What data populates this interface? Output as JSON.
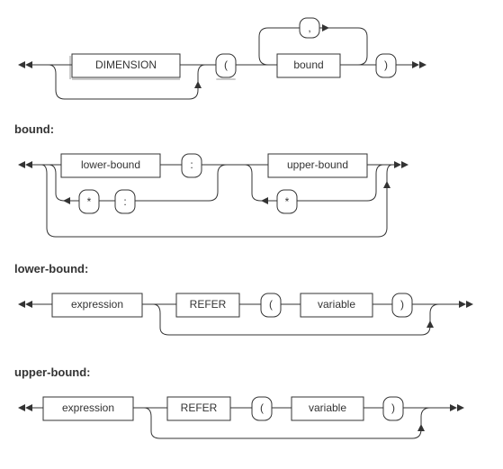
{
  "diagram1": {
    "dimension": "DIMENSION",
    "open_paren": "(",
    "bound": "bound",
    "comma": ",",
    "close_paren": ")"
  },
  "labels": {
    "bound": "bound:",
    "lower": "lower-bound:",
    "upper": "upper-bound:"
  },
  "diagram2": {
    "lower_bound": "lower-bound",
    "colon1": ":",
    "upper_bound": "upper-bound",
    "star1": "*",
    "colon2": ":",
    "star2": "*"
  },
  "diagram3": {
    "expression": "expression",
    "refer": "REFER",
    "open_paren": "(",
    "variable": "variable",
    "close_paren": ")"
  },
  "diagram4": {
    "expression": "expression",
    "refer": "REFER",
    "open_paren": "(",
    "variable": "variable",
    "close_paren": ")"
  }
}
